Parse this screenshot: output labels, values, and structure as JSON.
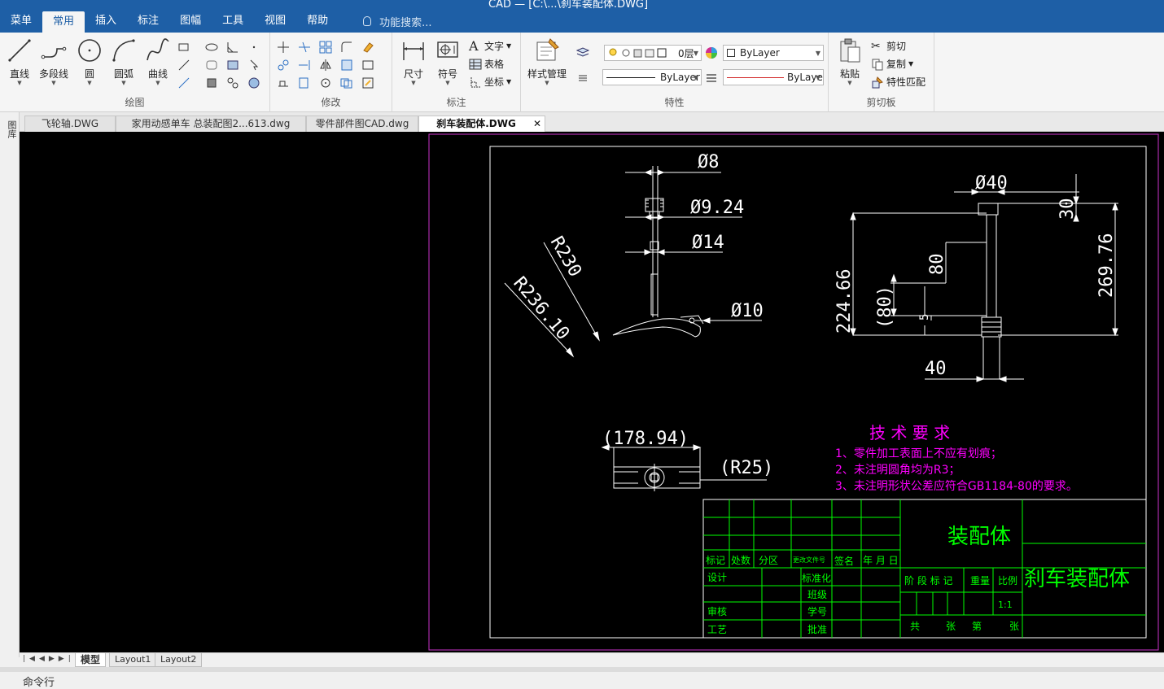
{
  "title_fragment": "CAD — [C:\\...\\刹车装配体.DWG]",
  "menu": {
    "tabs": [
      "菜单",
      "常用",
      "插入",
      "标注",
      "图幅",
      "工具",
      "视图",
      "帮助"
    ],
    "active_index": 1,
    "search_placeholder": "功能搜索..."
  },
  "ribbon": {
    "draw": {
      "label": "绘图",
      "buttons": [
        "直线",
        "多段线",
        "圆",
        "圆弧",
        "曲线"
      ]
    },
    "modify": {
      "label": "修改"
    },
    "annotate": {
      "label": "标注",
      "buttons": [
        "尺寸",
        "符号"
      ],
      "small": [
        "文字",
        "表格",
        "坐标"
      ]
    },
    "properties": {
      "label": "特性",
      "style_button": "样式管理",
      "layer_value": "0层",
      "color_value": "ByLayer",
      "linetype_value": "ByLayer",
      "lineweight_value": "ByLaye"
    },
    "clipboard": {
      "label": "剪切板",
      "paste": "粘贴",
      "cut": "剪切",
      "copy": "复制",
      "match": "特性匹配"
    }
  },
  "doc_tabs": [
    "飞轮轴.DWG",
    "家用动感单车 总装配图2...613.dwg",
    "零件部件图CAD.dwg",
    "刹车装配体.DWG"
  ],
  "active_doc_index": 3,
  "side_strip_label": "图库",
  "layout_tabs": [
    "模型",
    "Layout1",
    "Layout2"
  ],
  "command_label": "命令行",
  "drawing": {
    "dims_left": [
      "Ø8",
      "Ø9.24",
      "Ø14",
      "Ø10",
      "R230",
      "R236.10"
    ],
    "dims_right": [
      "Ø40",
      "30",
      "269.76",
      "224.66",
      "80",
      "(80)",
      "5",
      "40"
    ],
    "dims_bottom": [
      "(178.94)",
      "(R25)"
    ],
    "tech_title": "技  术  要  求",
    "tech_notes": [
      "1、零件加工表面上不应有划痕；",
      "2、未注明圆角均为R3；",
      "3、未注明形状公差应符合GB1184-80的要求。"
    ],
    "title_block": {
      "part_name": "装配体",
      "drawing_name": "刹车装配体",
      "row_headers": [
        "标记",
        "处数",
        "分区",
        "更改文件号",
        "签名",
        "年 月 日"
      ],
      "left_labels": [
        "设计",
        "审核",
        "工艺"
      ],
      "mid_labels": [
        "标准化",
        "班级",
        "学号",
        "批准"
      ],
      "stage": "阶 段 标 记",
      "weight": "重量",
      "scale_label": "比例",
      "scale_value": "1:1",
      "sheet_total": "共",
      "sheet_unit": "张",
      "sheet_num": "第",
      "sheet_unit2": "张"
    }
  },
  "colors": {
    "accent": "#1e5fa6",
    "canvas": "#000000",
    "line": "#ffffff",
    "green": "#00ff00",
    "magenta": "#ff00ff",
    "viewport": "#cc33cc"
  }
}
